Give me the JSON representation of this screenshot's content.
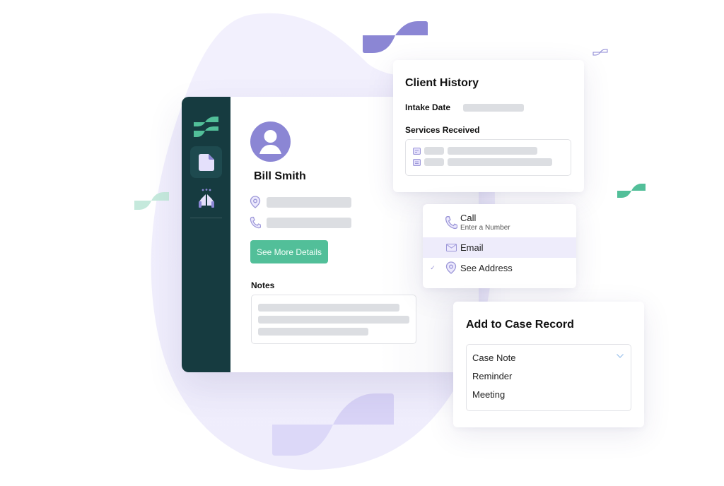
{
  "app": {
    "sidebar": {
      "items": [
        {
          "name": "logo",
          "icon": "brand-logo-icon"
        },
        {
          "name": "documents",
          "icon": "document-icon",
          "active": true
        },
        {
          "name": "support",
          "icon": "praying-hands-icon"
        }
      ]
    },
    "profile": {
      "name": "Bill Smith",
      "avatar_icon": "user-avatar-icon",
      "fields": [
        {
          "icon": "location-pin-icon",
          "value": ""
        },
        {
          "icon": "phone-icon",
          "value": ""
        }
      ],
      "details_button": "See More Details",
      "notes_label": "Notes"
    }
  },
  "client_history": {
    "title": "Client History",
    "intake_date_label": "Intake Date",
    "services_label": "Services Received",
    "services": [
      {
        "icon": "calendar-icon"
      },
      {
        "icon": "calendar-icon"
      }
    ]
  },
  "contact_menu": {
    "items": [
      {
        "label": "Call",
        "sublabel": "Enter a Number",
        "icon": "phone-icon",
        "active": false,
        "checked": false
      },
      {
        "label": "Email",
        "icon": "envelope-icon",
        "active": true,
        "checked": false
      },
      {
        "label": "See Address",
        "icon": "location-pin-icon",
        "active": false,
        "checked": true
      }
    ],
    "check_glyph": "✓"
  },
  "case_record": {
    "title": "Add to Case Record",
    "selected": "Case Note",
    "options": [
      "Case Note",
      "Reminder",
      "Meeting"
    ]
  },
  "colors": {
    "sidebar": "#163b40",
    "accent_green": "#52bf99",
    "accent_purple": "#8b86d4",
    "blob": "#f1effd",
    "highlight": "#eeecfb"
  }
}
